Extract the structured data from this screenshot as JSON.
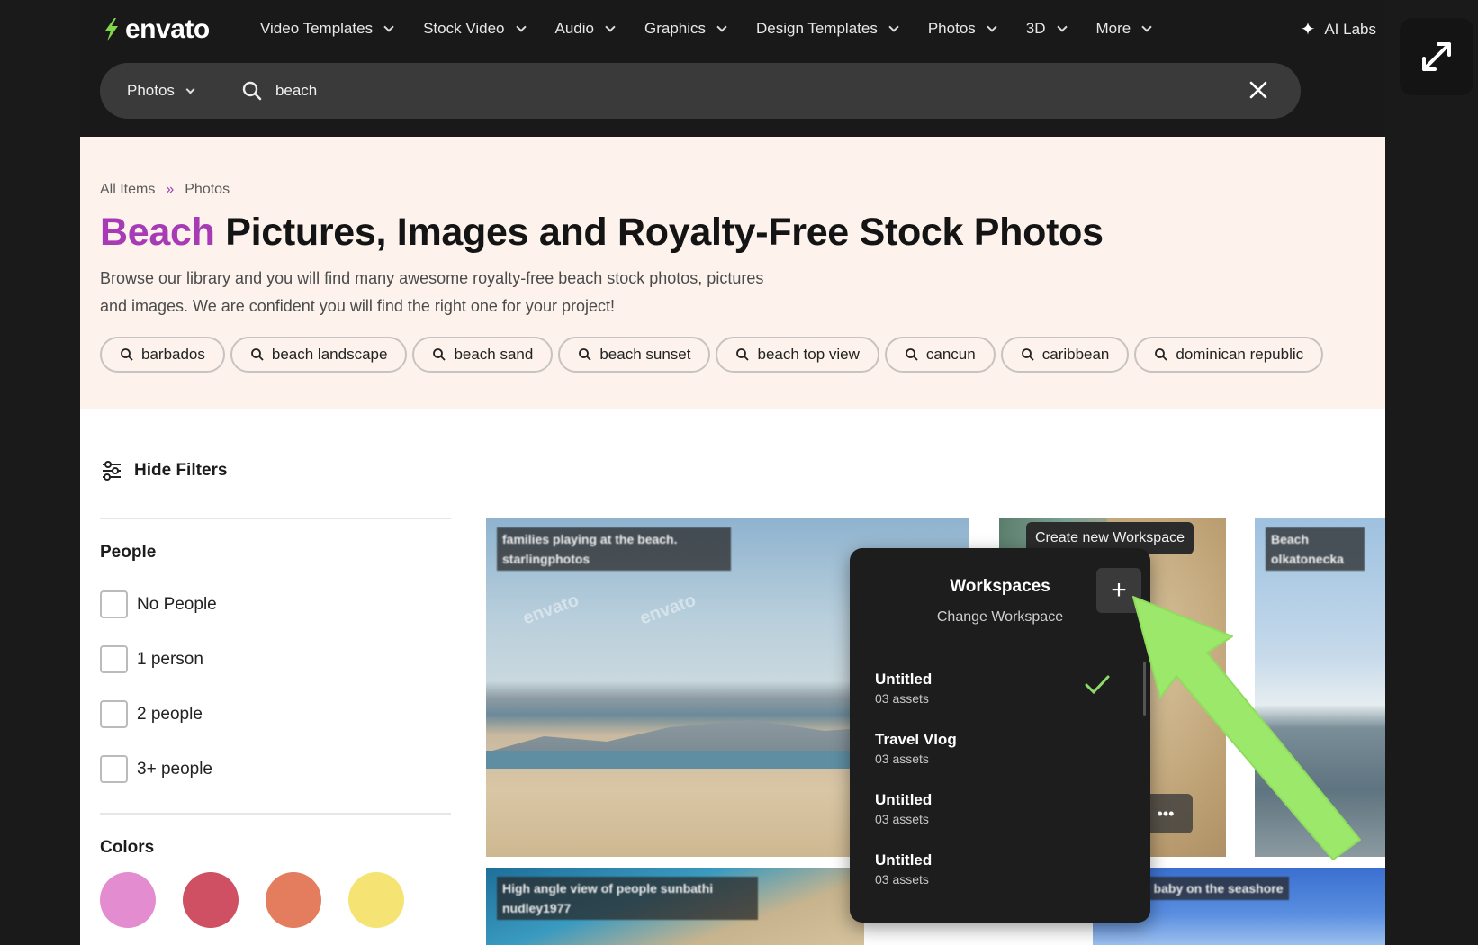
{
  "logo": {
    "text": "envato"
  },
  "nav": [
    {
      "label": "Video Templates"
    },
    {
      "label": "Stock Video"
    },
    {
      "label": "Audio"
    },
    {
      "label": "Graphics"
    },
    {
      "label": "Design Templates"
    },
    {
      "label": "Photos"
    },
    {
      "label": "3D"
    },
    {
      "label": "More"
    }
  ],
  "ai_labs": "AI Labs",
  "search": {
    "category": "Photos",
    "query": "beach"
  },
  "breadcrumb": {
    "root": "All Items",
    "sep": "»",
    "current": "Photos"
  },
  "hero": {
    "title_accent": "Beach",
    "title_rest": " Pictures, Images and Royalty-Free Stock Photos",
    "desc_line1": "Browse our library and you will find many awesome royalty-free beach stock photos, pictures",
    "desc_line2": "and images. We are confident you will find the right one for your project!"
  },
  "chips": [
    "barbados",
    "beach landscape",
    "beach sand",
    "beach sunset",
    "beach top view",
    "cancun",
    "caribbean",
    "dominican republic"
  ],
  "filters": {
    "hide_label": "Hide Filters",
    "people_title": "People",
    "people_options": [
      "No People",
      "1 person",
      "2 people",
      "3+ people"
    ],
    "colors_title": "Colors",
    "colors": [
      "#e38ccf",
      "#cf4f63",
      "#e47d5d",
      "#f5e374"
    ]
  },
  "images": {
    "caption_1": "families playing at the beach. starlingphotos",
    "caption_3": "Beach olkatonecka",
    "caption_4": "High angle view of people sunbathi nudley1977",
    "caption_5": "with her baby on the seashore",
    "watermark": "envato"
  },
  "tooltip": "Create new Workspace",
  "workspaces": {
    "title": "Workspaces",
    "subtitle": "Change Workspace",
    "items": [
      {
        "name": "Untitled",
        "count": "03 assets",
        "selected": true
      },
      {
        "name": "Travel Vlog",
        "count": "03 assets",
        "selected": false
      },
      {
        "name": "Untitled",
        "count": "03 assets",
        "selected": false
      },
      {
        "name": "Untitled",
        "count": "03 assets",
        "selected": false
      }
    ]
  },
  "colors": {
    "accent": "#a63bb5",
    "annotation": "#9be86a",
    "logo_green": "#82d64a"
  }
}
